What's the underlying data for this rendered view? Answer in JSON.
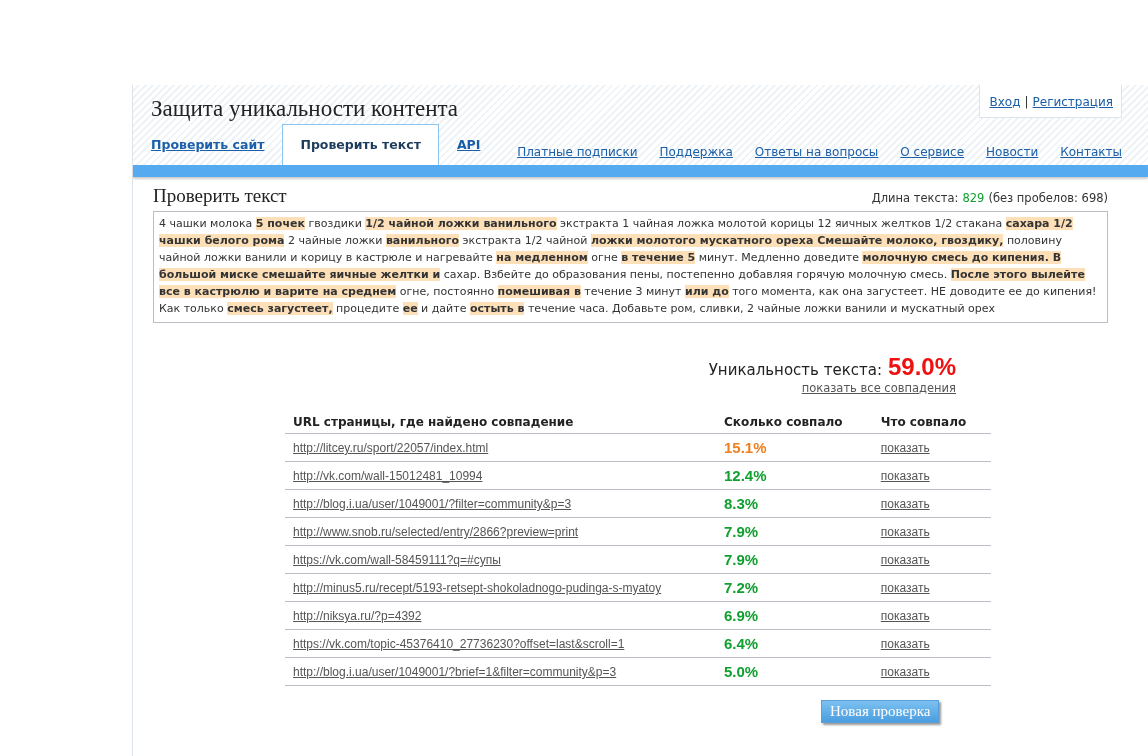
{
  "site_title": "Защита уникальности контента",
  "auth": {
    "login": "Вход",
    "separator": "|",
    "register": "Регистрация"
  },
  "tabs": [
    {
      "label": "Проверить сайт",
      "selected": false
    },
    {
      "label": "Проверить текст",
      "selected": true
    },
    {
      "label": "API",
      "selected": false
    }
  ],
  "nav_links": [
    "Платные подписки",
    "Поддержка",
    "Ответы на вопросы",
    "О сервисе",
    "Новости",
    "Контакты"
  ],
  "section_title": "Проверить текст",
  "text_length": {
    "label": "Длина текста:",
    "value": "829",
    "note": "(без пробелов: 698)"
  },
  "checked_text": "4 чашки молока **5 почек** гвоздики **1/2 чайной ложки ванильного** экстракта 1 чайная ложка молотой корицы 12 яичных желтков 1/2 стакана **сахара 1/2 чашки белого рома** 2 чайные ложки **ванильного** экстракта 1/2 чайной **ложки молотого мускатного ореха Смешайте молоко, гвоздику,** половину чайной ложки ванили и корицу в кастрюле и нагревайте **на медленном** огне **в течение 5** минут. Медленно доведите **молочную смесь до кипения. В большой миске смешайте яичные желтки и** сахар. Взбейте до образования пены, постепенно добавляя горячую молочную смесь. **После этого вылейте все в кастрюлю и варите на среднем** огне, постоянно **помешивая в** течение 3 минут **или до** того момента, как она загустеет. НЕ доводите ее до кипения! Как только **смесь загустеет,** процедите **ее** и дайте **остыть в** течение часа. Добавьте ром, сливки, 2 чайные ложки ванили и мускатный орех",
  "uniqueness": {
    "label": "Уникальность текста:",
    "value": "59.0%",
    "show_all": "показать все совпадения"
  },
  "table": {
    "columns": [
      "URL страницы, где найдено совпадение",
      "Сколько совпало",
      "Что совпало"
    ],
    "rows": [
      {
        "url": "http://litcey.ru/sport/22057/index.html",
        "percent": "15.1%",
        "color": "#f08020",
        "action": "показать"
      },
      {
        "url": "http://vk.com/wall-15012481_10994",
        "percent": "12.4%",
        "color": "#10a030",
        "action": "показать"
      },
      {
        "url": "http://blog.i.ua/user/1049001/?filter=community&p=3",
        "percent": "8.3%",
        "color": "#10a030",
        "action": "показать"
      },
      {
        "url": "http://www.snob.ru/selected/entry/2866?preview=print",
        "percent": "7.9%",
        "color": "#10a030",
        "action": "показать"
      },
      {
        "url": "https://vk.com/wall-58459111?q=#супы",
        "percent": "7.9%",
        "color": "#10a030",
        "action": "показать"
      },
      {
        "url": "http://minus5.ru/recept/5193-retsept-shokoladnogo-pudinga-s-myatoy",
        "percent": "7.2%",
        "color": "#10a030",
        "action": "показать"
      },
      {
        "url": "http://niksya.ru/?p=4392",
        "percent": "6.9%",
        "color": "#10a030",
        "action": "показать"
      },
      {
        "url": "https://vk.com/topic-45376410_27736230?offset=last&scroll=1",
        "percent": "6.4%",
        "color": "#10a030",
        "action": "показать"
      },
      {
        "url": "http://blog.i.ua/user/1049001/?brief=1&filter=community&p=3",
        "percent": "5.0%",
        "color": "#10a030",
        "action": "показать"
      }
    ]
  },
  "new_check_button": "Новая проверка"
}
